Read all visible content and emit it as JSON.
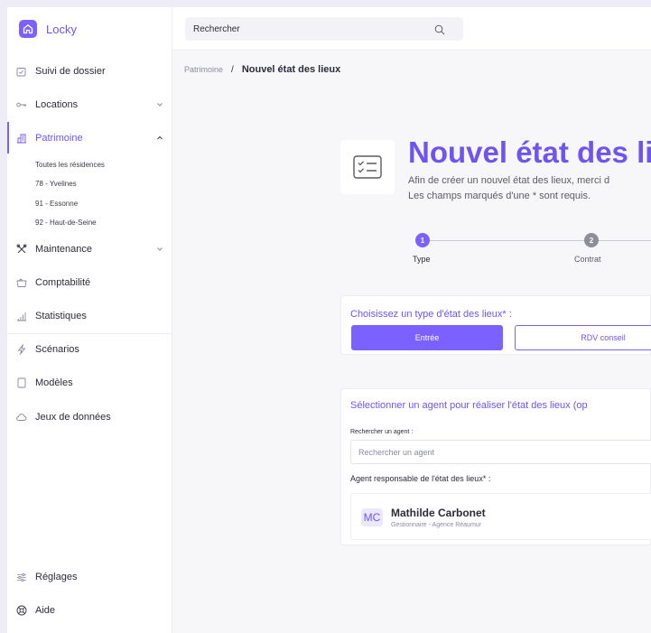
{
  "app": {
    "name": "Locky"
  },
  "search": {
    "placeholder": "Rechercher"
  },
  "sidebar": {
    "items": [
      {
        "label": "Suivi de dossier",
        "icon": "folder-check-icon"
      },
      {
        "label": "Locations",
        "icon": "key-icon"
      },
      {
        "label": "Patrimoine",
        "icon": "building-icon"
      },
      {
        "label": "Maintenance",
        "icon": "tools-icon"
      },
      {
        "label": "Comptabilité",
        "icon": "wallet-icon"
      },
      {
        "label": "Statistiques",
        "icon": "bar-chart-icon"
      },
      {
        "label": "Scénarios",
        "icon": "lightning-icon"
      },
      {
        "label": "Modèles",
        "icon": "document-icon"
      },
      {
        "label": "Jeux de données",
        "icon": "cloud-icon"
      }
    ],
    "patrimoine_sub": [
      "Toutes les résidences",
      "78 - Yvelines",
      "91 - Essonne",
      "92 - Haut-de-Seine"
    ],
    "bottom": [
      {
        "label": "Réglages",
        "icon": "sliders-icon"
      },
      {
        "label": "Aide",
        "icon": "lifebuoy-icon"
      }
    ]
  },
  "breadcrumb": {
    "parent": "Patrimoine",
    "separator": "/",
    "current": "Nouvel état des lieux"
  },
  "header": {
    "title": "Nouvel état des lie",
    "description_line1": "Afin de créer un nouvel état des lieux, merci d",
    "description_line2": "Les champs marqués d'une * sont requis."
  },
  "stepper": {
    "steps": [
      {
        "number": "1",
        "label": "Type",
        "state": "active"
      },
      {
        "number": "2",
        "label": "Contrat",
        "state": "pending"
      }
    ]
  },
  "type_section": {
    "title": "Choisissez un type d'état des lieux* :",
    "options": [
      "Entrée",
      "RDV conseil"
    ],
    "selected": "Entrée"
  },
  "agent_section": {
    "title": "Sélectionner un agent pour réaliser l'état des lieux (op",
    "search_label": "Rechercher un agent :",
    "search_placeholder": "Rechercher un agent",
    "responsible_label": "Agent responsable de l'état des lieux* :",
    "agent": {
      "initials": "MC",
      "name": "Mathilde Carbonet",
      "role": "Gestionnaire - Agence Réaumur"
    }
  },
  "colors": {
    "accent": "#7b61ff",
    "accent_text": "#6f55f0",
    "step_pending": "#8e8e9a"
  }
}
